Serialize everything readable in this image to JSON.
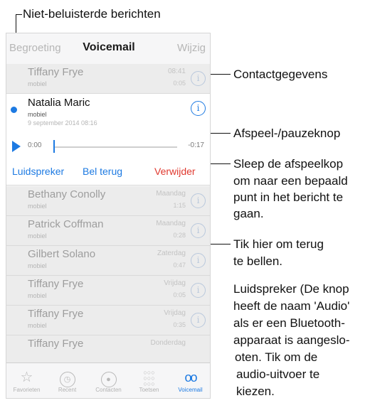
{
  "callouts": {
    "unheard": "Niet-beluisterde berichten",
    "contact": "Contactgegevens",
    "play_pause": "Afspeel-/pauzeknop",
    "scrub": [
      "Sleep de afspeelkop",
      "om naar een bepaald",
      "punt in het bericht te",
      "gaan."
    ],
    "call_back": [
      "Tik hier om terug",
      "te bellen."
    ],
    "speaker": [
      "Luidspreker (De knop",
      "heeft de naam 'Audio'",
      "als er een Bluetooth-",
      "apparaat is aangeslo-",
      "oten. Tik om de",
      "audio-uitvoer te",
      "kiezen."
    ]
  },
  "navbar": {
    "left": "Begroeting",
    "title": "Voicemail",
    "right": "Wijzig"
  },
  "first_row": {
    "name": "Tiffany Frye",
    "sub": "mobiel",
    "day": "08:41",
    "time": "0:05"
  },
  "selected": {
    "name": "Natalia Maric",
    "sub": "mobiel",
    "date": "9 september 2014 08:16",
    "time_start": "0:00",
    "time_end": "-0:17",
    "progress": 0.0,
    "speaker_label": "Luidspreker",
    "callback_label": "Bel terug",
    "delete_label": "Verwijder"
  },
  "rows": [
    {
      "name": "Bethany Conolly",
      "sub": "mobiel",
      "day": "Maandag",
      "time": "1:15"
    },
    {
      "name": "Patrick Coffman",
      "sub": "mobiel",
      "day": "Maandag",
      "time": "0:28"
    },
    {
      "name": "Gilbert Solano",
      "sub": "mobiel",
      "day": "Zaterdag",
      "time": "0:47"
    },
    {
      "name": "Tiffany Frye",
      "sub": "mobiel",
      "day": "Vrijdag",
      "time": "0:05"
    },
    {
      "name": "Tiffany Frye",
      "sub": "mobiel",
      "day": "Vrijdag",
      "time": "0:35"
    },
    {
      "name": "Tiffany Frye",
      "sub": "",
      "day": "Donderdag",
      "time": ""
    }
  ],
  "tabs": [
    {
      "label": "Favorieten",
      "icon": "star-icon"
    },
    {
      "label": "Recent",
      "icon": "clock-icon"
    },
    {
      "label": "Contacten",
      "icon": "contacts-icon"
    },
    {
      "label": "Toetsen",
      "icon": "keypad-icon"
    },
    {
      "label": "Voicemail",
      "icon": "voicemail-icon",
      "active": true
    }
  ],
  "colors": {
    "accent": "#1d7ae2",
    "delete": "#e0392f",
    "unread_dot": "#1d7ae2"
  }
}
